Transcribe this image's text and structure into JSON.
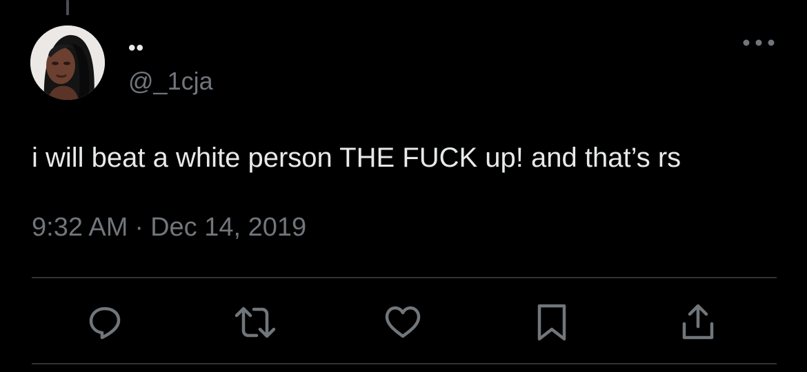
{
  "tweet": {
    "display_name": "••",
    "handle": "@_1cja",
    "text": "i will beat a white person THE FUCK up! and that’s rs",
    "time": "9:32 AM",
    "separator": "·",
    "date": "Dec 14, 2019"
  },
  "icons": {
    "more": "more-horizontal-icon",
    "reply": "reply-icon",
    "retweet": "retweet-icon",
    "like": "heart-icon",
    "bookmark": "bookmark-icon",
    "share": "share-icon"
  },
  "colors": {
    "background": "#000000",
    "primary_text": "#e7e9ea",
    "secondary_text": "#71767b",
    "divider": "#2f3336"
  }
}
